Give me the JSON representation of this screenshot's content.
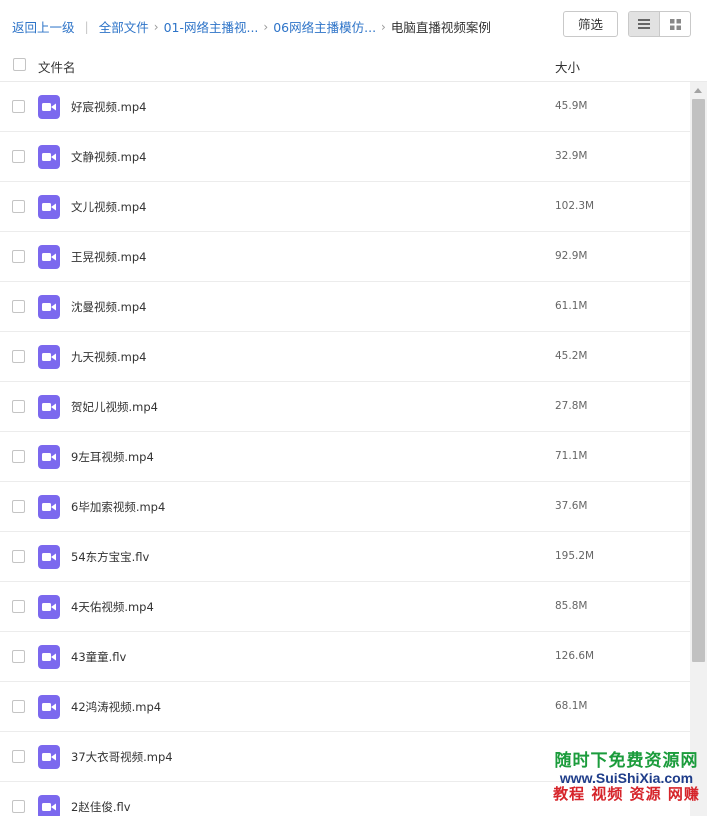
{
  "breadcrumb": {
    "back": "返回上一级",
    "all": "全部文件",
    "level1": "01-网络主播视...",
    "level2": "06网络主播模仿...",
    "current": "电脑直播视频案例"
  },
  "toolbar": {
    "filter_label": "筛选",
    "view_list_icon": "list-view-icon",
    "view_grid_icon": "grid-view-icon"
  },
  "columns": {
    "name": "文件名",
    "size": "大小"
  },
  "colors": {
    "video_icon": "#7b68ee",
    "link": "#2e74c8"
  },
  "files": [
    {
      "name": "好宸视频.mp4",
      "size": "45.9M"
    },
    {
      "name": "文静视频.mp4",
      "size": "32.9M"
    },
    {
      "name": "文儿视频.mp4",
      "size": "102.3M"
    },
    {
      "name": "王晃视频.mp4",
      "size": "92.9M"
    },
    {
      "name": "沈曼视频.mp4",
      "size": "61.1M"
    },
    {
      "name": "九天视频.mp4",
      "size": "45.2M"
    },
    {
      "name": "贺妃儿视频.mp4",
      "size": "27.8M"
    },
    {
      "name": "9左耳视频.mp4",
      "size": "71.1M"
    },
    {
      "name": "6毕加索视频.mp4",
      "size": "37.6M"
    },
    {
      "name": "54东方宝宝.flv",
      "size": "195.2M"
    },
    {
      "name": "4天佑视频.mp4",
      "size": "85.8M"
    },
    {
      "name": "43童童.flv",
      "size": "126.6M"
    },
    {
      "name": "42鸿涛视频.mp4",
      "size": "68.1M"
    },
    {
      "name": "37大衣哥视频.mp4",
      "size": ""
    },
    {
      "name": "2赵佳俊.flv",
      "size": ""
    }
  ],
  "watermark": {
    "line1": "随时下免费资源网",
    "line2": "www.SuiShiXia.com",
    "line3": "教程 视频 资源 网赚"
  }
}
